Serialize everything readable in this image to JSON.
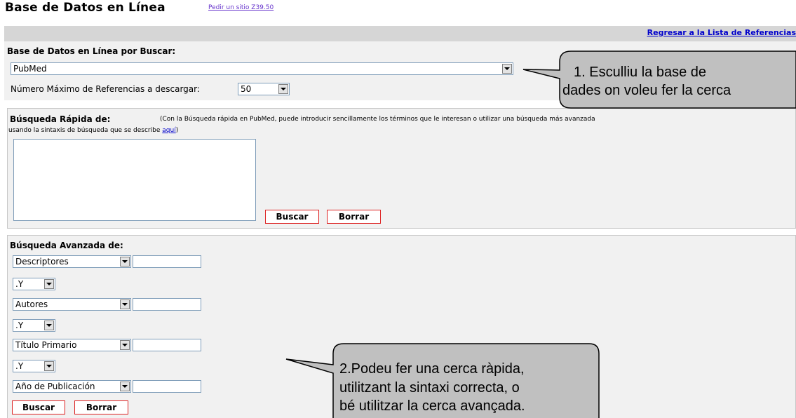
{
  "header": {
    "title": "Base de Datos en Línea",
    "z3950_link": "Pedir un sitio Z39.50",
    "back_link": "Regresar a la Lista de Referencias"
  },
  "database": {
    "heading": "Base de Datos en Línea por Buscar:",
    "selected": "PubMed",
    "max_refs_label": "Número Máximo de Referencias a descargar:",
    "max_refs_value": "50"
  },
  "quick_search": {
    "heading": "Búsqueda Rápida de:",
    "description": "(Con la Búsqueda rápida en PubMed, puede introducir sencillamente los términos que le interesan o utilizar una búsqueda más avanzada",
    "description_line2": "usando la sintaxis de búsqueda que se describe",
    "link": "aquí",
    "close_paren": ")",
    "textarea_value": "",
    "buscar_label": "Buscar",
    "borrar_label": "Borrar"
  },
  "advanced_search": {
    "heading": "Búsqueda Avanzada de:",
    "fields": [
      {
        "field": "Descriptores",
        "value": ""
      },
      {
        "field": "Autores",
        "value": ""
      },
      {
        "field": "Título Primario",
        "value": ""
      },
      {
        "field": "Año de Publicación",
        "value": ""
      }
    ],
    "operators": [
      ".Y",
      ".Y",
      ".Y"
    ],
    "buscar_label": "Buscar",
    "borrar_label": "Borrar"
  },
  "callouts": {
    "c1_line1": "1. Esculliu la base de",
    "c1_line2": "dades on voleu fer la cerca",
    "c2_line1": "2.Podeu fer una cerca ràpida,",
    "c2_line2": "utilitzant la sintaxi correcta, o",
    "c2_line3": "bé utilitzar la cerca avançada."
  },
  "colors": {
    "callout_fill": "#c0c0c0",
    "button_border": "#dd2222",
    "link": "#0000cc"
  }
}
